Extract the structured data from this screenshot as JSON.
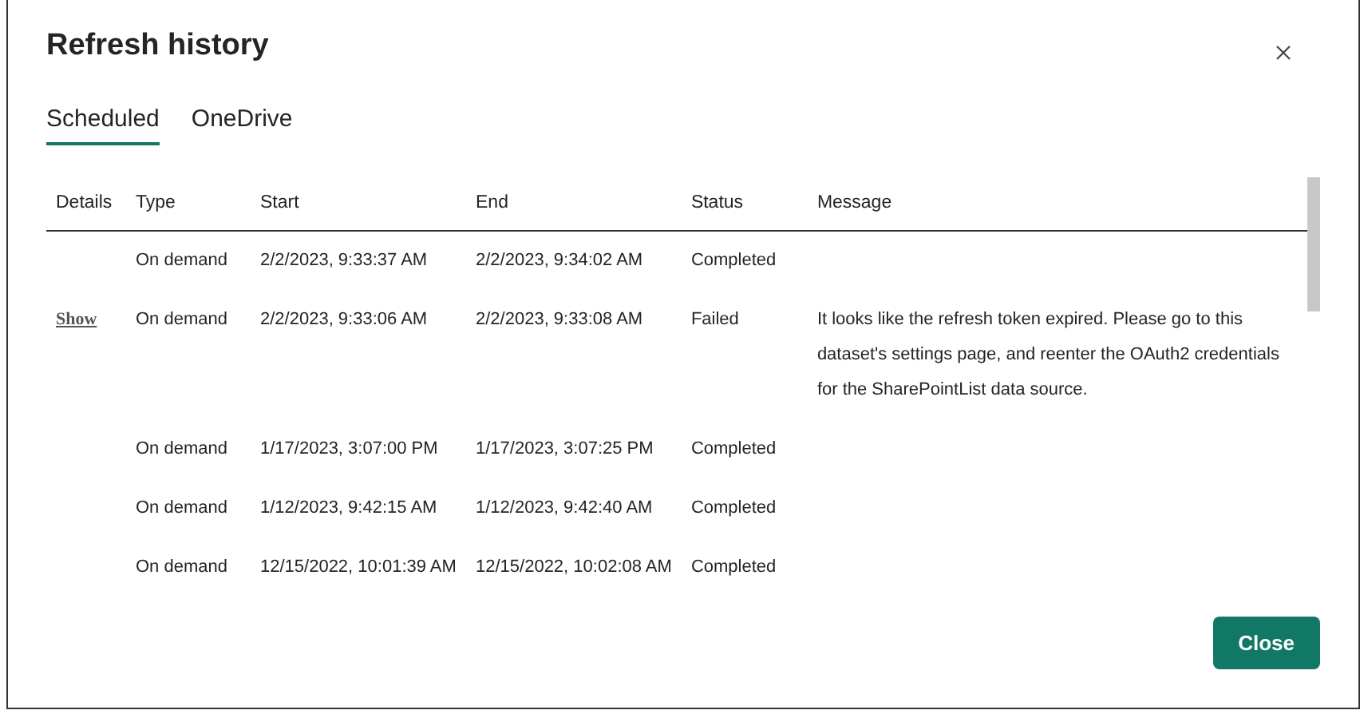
{
  "dialog": {
    "title": "Refresh history"
  },
  "tabs": [
    {
      "label": "Scheduled",
      "selected": true
    },
    {
      "label": "OneDrive",
      "selected": false
    }
  ],
  "table": {
    "columns": [
      "Details",
      "Type",
      "Start",
      "End",
      "Status",
      "Message"
    ],
    "rows": [
      {
        "type": "On demand",
        "start": "2/2/2023, 9:33:37 AM",
        "end": "2/2/2023, 9:34:02 AM",
        "status": "Completed"
      },
      {
        "details": "Show",
        "type": "On demand",
        "start": "2/2/2023, 9:33:06 AM",
        "end": "2/2/2023, 9:33:08 AM",
        "status": "Failed",
        "message": "It looks like the refresh token expired. Please go to this dataset's settings page, and reenter the OAuth2 credentials for the SharePointList data source."
      },
      {
        "type": "On demand",
        "start": "1/17/2023, 3:07:00 PM",
        "end": "1/17/2023, 3:07:25 PM",
        "status": "Completed"
      },
      {
        "type": "On demand",
        "start": "1/12/2023, 9:42:15 AM",
        "end": "1/12/2023, 9:42:40 AM",
        "status": "Completed"
      },
      {
        "type": "On demand",
        "start": "12/15/2022, 10:01:39 AM",
        "end": "12/15/2022, 10:02:08 AM",
        "status": "Completed"
      }
    ]
  },
  "buttons": [
    "Close"
  ]
}
